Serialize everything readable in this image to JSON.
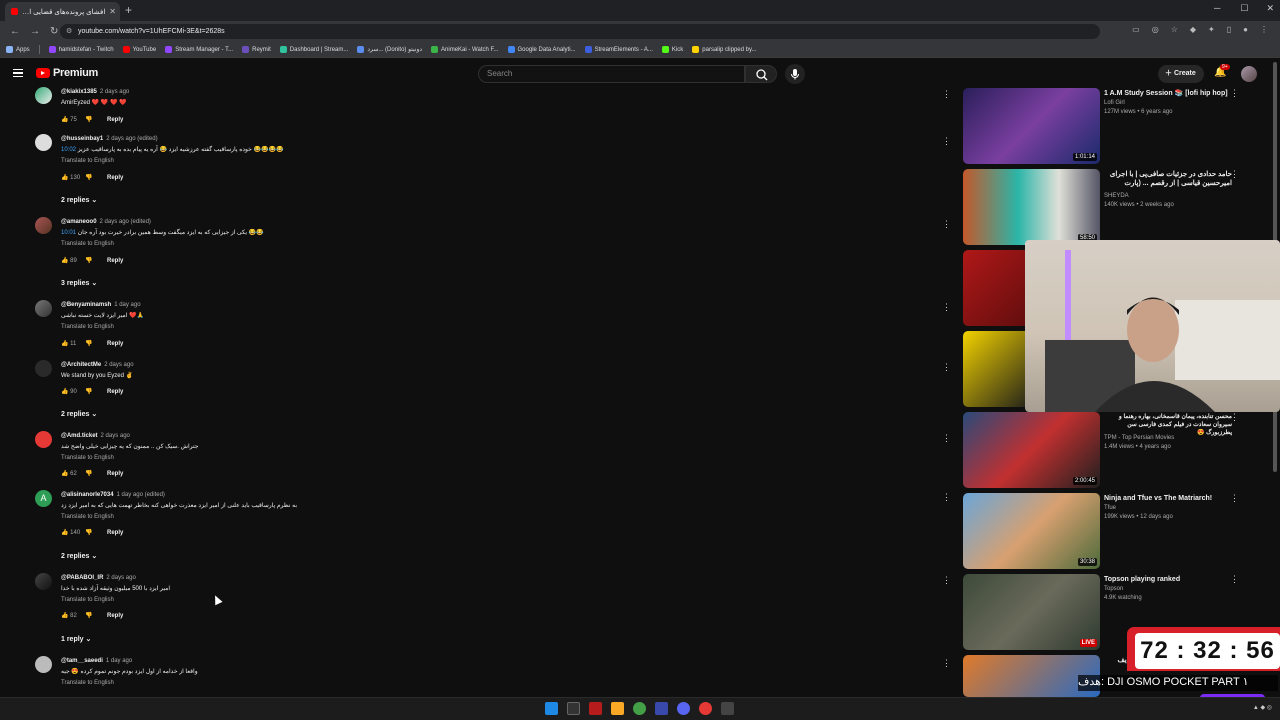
{
  "browser": {
    "tab_title": "افشای پرونده‌های قضایی امیر (0)",
    "url": "youtube.com/watch?v=1UhEFCMi-3E&t=2628s",
    "bookmarks": [
      "Apps",
      "hamidstefan - Twitch",
      "YouTube",
      "Stream Manager - T...",
      "Reymit",
      "Dashboard | Stream...",
      "سرد... (Donito) دونیتو",
      "AnimeKai - Watch F...",
      "Google Data Analyti...",
      "StreamElements - A...",
      "Kick",
      "parsalip clipped by..."
    ]
  },
  "youtube": {
    "logo_text": "Premium",
    "search_placeholder": "Search",
    "create_label": "Create",
    "notif_count": "9+"
  },
  "comments": [
    {
      "user": "@kiakix1385",
      "when": "2 days ago",
      "text": "AmirEyzed ❤️ ❤️ ❤️ ❤️",
      "translate": "",
      "likes": "75",
      "reply": "Reply",
      "replies": ""
    },
    {
      "user": "@husseinbay1",
      "when": "2 days ago (edited)",
      "text": "خوده پارساقیب گفته عرزشیه ایزد 😂 آره یه پیام بده به پارساقیب عزیز 😂😂😂😂",
      "ts": "10:02",
      "translate": "Translate to English",
      "likes": "130",
      "reply": "Reply",
      "replies": "2 replies"
    },
    {
      "user": "@amaneoo0",
      "when": "2 days ago (edited)",
      "text": "یکی از جیزایی که به ایزد میگفت وسط همین برادر خیرت بود آره جان 😂😂",
      "ts": "10:01",
      "translate": "Translate to English",
      "likes": "89",
      "reply": "Reply",
      "replies": "3 replies"
    },
    {
      "user": "@Benyaminamsh",
      "when": "1 day ago",
      "text": "امیر ایزد لایت خسته نباشی ❤️🙏",
      "translate": "Translate to English",
      "likes": "11",
      "reply": "Reply",
      "replies": ""
    },
    {
      "user": "@ArchitectMe",
      "when": "2 days ago",
      "text": "We stand by you Eyzed ✌️",
      "translate": "",
      "likes": "90",
      "reply": "Reply",
      "replies": "2 replies"
    },
    {
      "user": "@Amd.ticket",
      "when": "2 days ago",
      "text": "جتراش .سیک کن .. ممنون که یه چیزایی خیلی واضح شد",
      "translate": "Translate to English",
      "likes": "62",
      "reply": "Reply",
      "replies": ""
    },
    {
      "user": "@alisinanorle7034",
      "when": "1 day ago (edited)",
      "text": "به نظرم پارساقیب باید علنی از امیر ایزد معذرت خواهی کنه بخاطر تهمت هایی که به امیر ایزد زد",
      "translate": "Translate to English",
      "likes": "140",
      "reply": "Reply",
      "replies": "2 replies"
    },
    {
      "user": "@PABABOI_IR",
      "when": "2 days ago",
      "text": "امیر ایزد با 500 میلیون وثیقه آزاد شده با خدا",
      "translate": "Translate to English",
      "likes": "82",
      "reply": "Reply",
      "replies": "1 reply"
    },
    {
      "user": "@tam__saeedi",
      "when": "1 day ago",
      "text": "واقعا از خدامه از اول ایزد بودم جونم تموم کرده 😍 جیه",
      "translate": "Translate to English",
      "likes": "",
      "reply": "",
      "replies": ""
    }
  ],
  "recommendations": [
    {
      "title": "1 A.M Study Session 📚 [lofi hip hop]",
      "channel": "Lofi Girl",
      "meta": "127M views • 6 years ago",
      "duration": "1:01:14"
    },
    {
      "title": "حامد حدادی در جزئیات صافی‌پی | با اجرای امیرحسین قیاسی | از رقصم ... (پارت",
      "channel": "SHEYDA",
      "meta": "140K views • 2 weeks ago",
      "duration": "58:50"
    },
    {
      "title": "",
      "channel": "",
      "meta": "",
      "duration": ""
    },
    {
      "title": "",
      "channel": "",
      "meta": "",
      "duration": ""
    },
    {
      "title": "محسن تنابنده، پیمان قاسمخانی، بهاره رهنما و سیروان سعادت در فیلم کمدی فارسی سن پطرزبورگ 😍",
      "channel": "TPM - Top Persian Movies",
      "meta": "1.4M views • 4 years ago",
      "duration": "2:00:45"
    },
    {
      "title": "Ninja and Tfue vs The Matriarch!",
      "channel": "Tfue",
      "meta": "199K views • 12 days ago",
      "duration": "30:38"
    },
    {
      "title": "Topson playing ranked",
      "channel": "Topson",
      "meta": "4.9K watching",
      "duration": "LIVE"
    },
    {
      "title": "داگ لایف",
      "channel": "",
      "meta": "",
      "duration": ""
    }
  ],
  "overlay": {
    "timer": "72 : 32 : 56",
    "goal_text": "هدف: DJI OSMO POCKET PART ۱"
  },
  "colors": {
    "accent": "#ff0000",
    "link": "#3ea6ff",
    "timer_bg": "#d8202a",
    "goal_bar": "#7b2cf3"
  }
}
